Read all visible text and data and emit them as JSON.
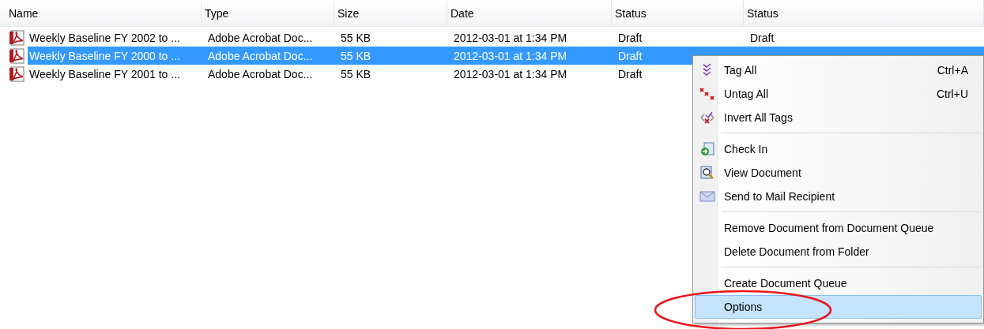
{
  "table": {
    "columns": [
      "Name",
      "Type",
      "Size",
      "Date",
      "Status",
      "Status"
    ],
    "rows": [
      {
        "selected": false,
        "cells": [
          "Weekly Baseline FY 2002 to ...",
          "Adobe Acrobat Doc...",
          "55 KB",
          "2012-03-01 at 1:34 PM",
          "Draft",
          "Draft"
        ]
      },
      {
        "selected": true,
        "cells": [
          "Weekly Baseline FY 2000 to ...",
          "Adobe Acrobat Doc...",
          "55 KB",
          "2012-03-01 at 1:34 PM",
          "Draft"
        ]
      },
      {
        "selected": false,
        "cells": [
          "Weekly Baseline FY 2001 to ...",
          "Adobe Acrobat Doc...",
          "55 KB",
          "2012-03-01 at 1:34 PM",
          "Draft"
        ]
      }
    ]
  },
  "context_menu": {
    "groups": [
      [
        {
          "label": "Tag All",
          "shortcut": "Ctrl+A",
          "selected": false
        },
        {
          "label": "Untag All",
          "shortcut": "Ctrl+U",
          "selected": false
        },
        {
          "label": "Invert All Tags",
          "selected": false
        }
      ],
      [
        {
          "label": "Check In",
          "selected": false
        },
        {
          "label": "View Document",
          "selected": false
        },
        {
          "label": "Send to Mail Recipient",
          "selected": false
        }
      ],
      [
        {
          "label": "Remove Document from Document Queue",
          "selected": false
        },
        {
          "label": "Delete Document from Folder",
          "selected": false
        }
      ],
      [
        {
          "label": "Create Document Queue",
          "selected": false
        },
        {
          "label": "Options",
          "selected": true
        }
      ]
    ]
  }
}
